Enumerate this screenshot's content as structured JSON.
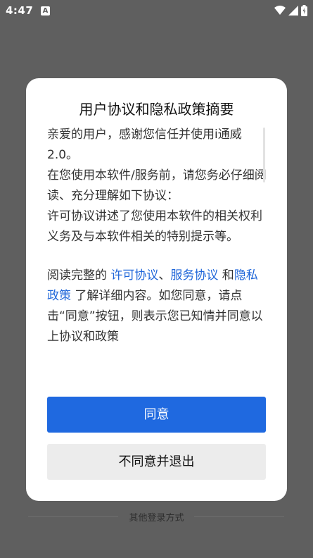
{
  "status_bar": {
    "time": "4:47",
    "notification_icon": "A",
    "icons": [
      "wifi-icon",
      "signal-icon",
      "battery-icon"
    ]
  },
  "dialog": {
    "title": "用户协议和隐私政策摘要",
    "paragraphs": [
      "亲爱的用户，感谢您信任并使用i通威2.0。",
      "在您使用本软件/服务前，请您务必仔细阅读、充分理解如下协议：",
      "许可协议讲述了您使用本软件的相关权利义务及与本软件相关的特别提示等。"
    ],
    "read_prefix": "阅读完整的 ",
    "link_license": "许可协议",
    "sep1": "、",
    "link_service": "服务协议",
    "and_text": " 和",
    "link_privacy": "隐私政策",
    "read_suffix": " 了解详细内容。如您同意，请点击“同意”按钮，则表示您已知情并同意以上协议和政策",
    "agree_label": "同意",
    "disagree_label": "不同意并退出"
  },
  "footer": {
    "other_login_label": "其他登录方式"
  },
  "colors": {
    "primary": "#1f69e0",
    "link": "#1f66d9",
    "overlay": "#5f5f5f"
  }
}
